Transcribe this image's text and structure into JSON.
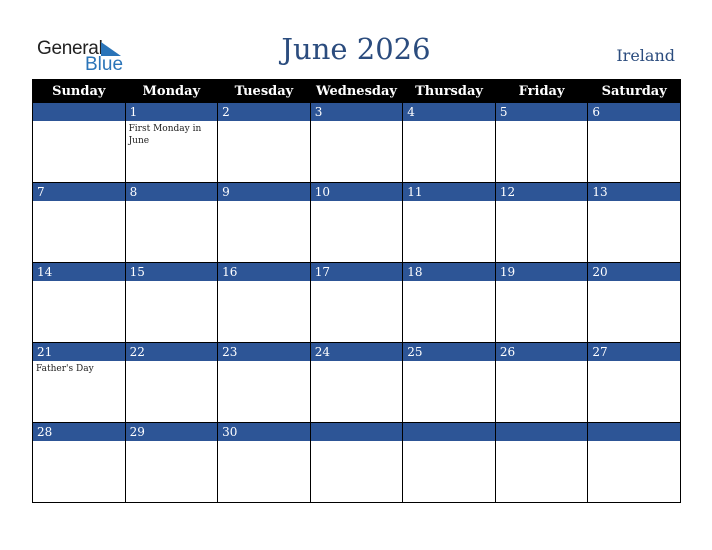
{
  "logo": {
    "line1": "General",
    "line2": "Blue"
  },
  "header": {
    "title": "June 2026",
    "country": "Ireland"
  },
  "days": [
    "Sunday",
    "Monday",
    "Tuesday",
    "Wednesday",
    "Thursday",
    "Friday",
    "Saturday"
  ],
  "weeks": [
    [
      {
        "d": "",
        "e": ""
      },
      {
        "d": "1",
        "e": "First Monday in June"
      },
      {
        "d": "2",
        "e": ""
      },
      {
        "d": "3",
        "e": ""
      },
      {
        "d": "4",
        "e": ""
      },
      {
        "d": "5",
        "e": ""
      },
      {
        "d": "6",
        "e": ""
      }
    ],
    [
      {
        "d": "7",
        "e": ""
      },
      {
        "d": "8",
        "e": ""
      },
      {
        "d": "9",
        "e": ""
      },
      {
        "d": "10",
        "e": ""
      },
      {
        "d": "11",
        "e": ""
      },
      {
        "d": "12",
        "e": ""
      },
      {
        "d": "13",
        "e": ""
      }
    ],
    [
      {
        "d": "14",
        "e": ""
      },
      {
        "d": "15",
        "e": ""
      },
      {
        "d": "16",
        "e": ""
      },
      {
        "d": "17",
        "e": ""
      },
      {
        "d": "18",
        "e": ""
      },
      {
        "d": "19",
        "e": ""
      },
      {
        "d": "20",
        "e": ""
      }
    ],
    [
      {
        "d": "21",
        "e": "Father's Day"
      },
      {
        "d": "22",
        "e": ""
      },
      {
        "d": "23",
        "e": ""
      },
      {
        "d": "24",
        "e": ""
      },
      {
        "d": "25",
        "e": ""
      },
      {
        "d": "26",
        "e": ""
      },
      {
        "d": "27",
        "e": ""
      }
    ],
    [
      {
        "d": "28",
        "e": ""
      },
      {
        "d": "29",
        "e": ""
      },
      {
        "d": "30",
        "e": ""
      },
      {
        "d": "",
        "e": ""
      },
      {
        "d": "",
        "e": ""
      },
      {
        "d": "",
        "e": ""
      },
      {
        "d": "",
        "e": ""
      }
    ]
  ]
}
